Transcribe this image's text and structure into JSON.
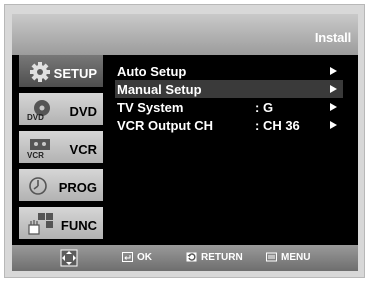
{
  "header": {
    "title": "Install"
  },
  "sidebar": {
    "items": [
      {
        "label": "SETUP",
        "icon": "gear-icon",
        "active": true
      },
      {
        "label": "DVD",
        "icon": "dvd-disc-icon",
        "active": false,
        "icon_text": "DVD"
      },
      {
        "label": "VCR",
        "icon": "vcr-tape-icon",
        "active": false,
        "icon_text": "VCR"
      },
      {
        "label": "PROG",
        "icon": "clock-icon",
        "active": false
      },
      {
        "label": "FUNC",
        "icon": "hand-grid-icon",
        "active": false
      }
    ]
  },
  "menu": {
    "items": [
      {
        "name": "Auto Setup",
        "value": "",
        "selected": false
      },
      {
        "name": "Manual Setup",
        "value": "",
        "selected": true
      },
      {
        "name": "TV System",
        "value": ": G",
        "selected": false
      },
      {
        "name": "VCR Output CH",
        "value": ": CH 36",
        "selected": false
      }
    ]
  },
  "footer": {
    "nav_icon": "directional-pad-icon",
    "ok_label": "OK",
    "return_label": "RETURN",
    "menu_label": "MENU"
  }
}
